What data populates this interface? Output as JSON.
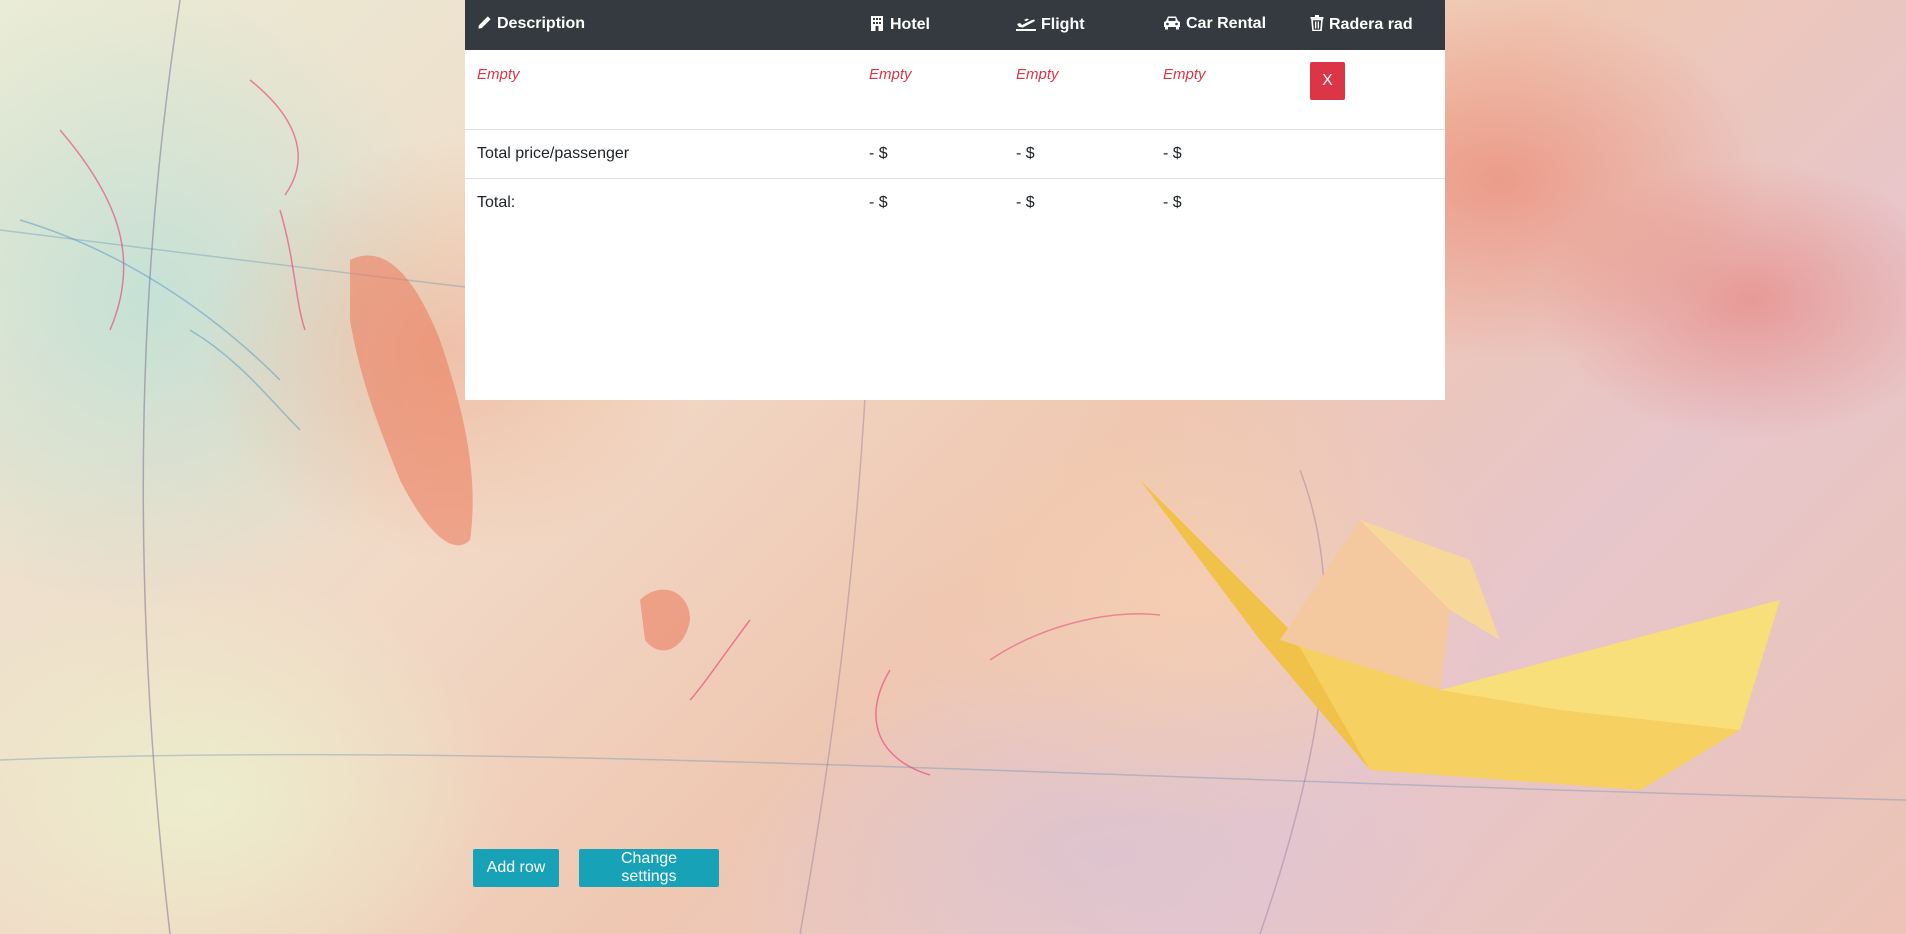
{
  "table": {
    "headers": {
      "description": "Description",
      "hotel": "Hotel",
      "flight": "Flight",
      "car_rental": "Car Rental",
      "delete_row": "Radera rad"
    },
    "header_icons": {
      "description": "pencil-icon",
      "hotel": "building-icon",
      "flight": "plane-departure-icon",
      "car_rental": "car-icon",
      "delete_row": "trash-icon"
    },
    "rows": [
      {
        "description": "Empty",
        "hotel": "Empty",
        "flight": "Empty",
        "car_rental": "Empty",
        "delete_label": "X"
      }
    ],
    "price_per_passenger": {
      "label": "Total price/passenger",
      "hotel": "- $",
      "flight": "- $",
      "car_rental": "- $"
    },
    "total": {
      "label": "Total:",
      "hotel": "- $",
      "flight": "- $",
      "car_rental": "- $"
    }
  },
  "actions": {
    "add_row": "Add row",
    "change_settings": "Change settings"
  },
  "colors": {
    "header_bg": "#343a40",
    "empty_text": "#dc3545",
    "delete_button": "#dc3545",
    "action_button": "#17a2b8"
  }
}
